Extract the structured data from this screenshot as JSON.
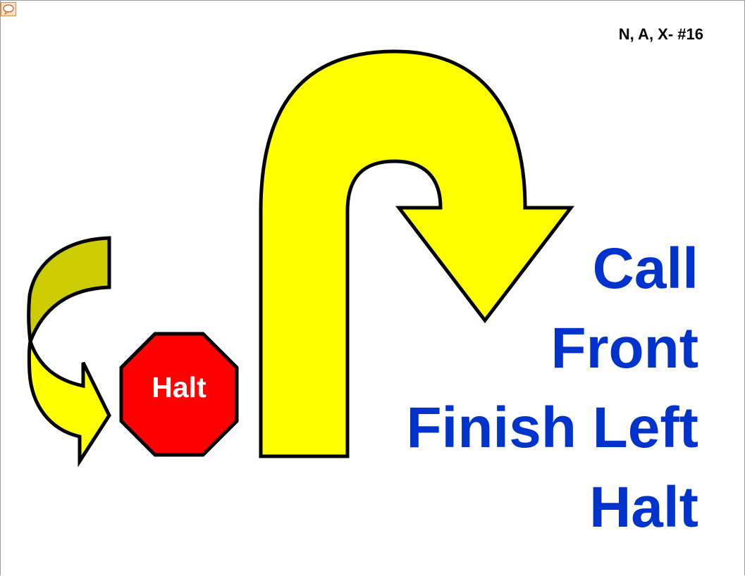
{
  "slide": {
    "id_label": "N, A, X- #16",
    "sign_label": "Halt",
    "title_lines": [
      "Call",
      "Front",
      "Finish Left",
      "Halt"
    ]
  },
  "colors": {
    "arrow_yellow": "#ffff00",
    "arrow_shade": "#cccc00",
    "sign_red": "#ff0000",
    "title_blue": "#0033cc",
    "outline": "#000000"
  },
  "icons": {
    "comment": "comment-bubble-icon",
    "u_turn_arrow": "u-turn-arrow-icon",
    "curved_arrow": "curved-arrow-icon",
    "stop_sign": "stop-sign-icon"
  }
}
